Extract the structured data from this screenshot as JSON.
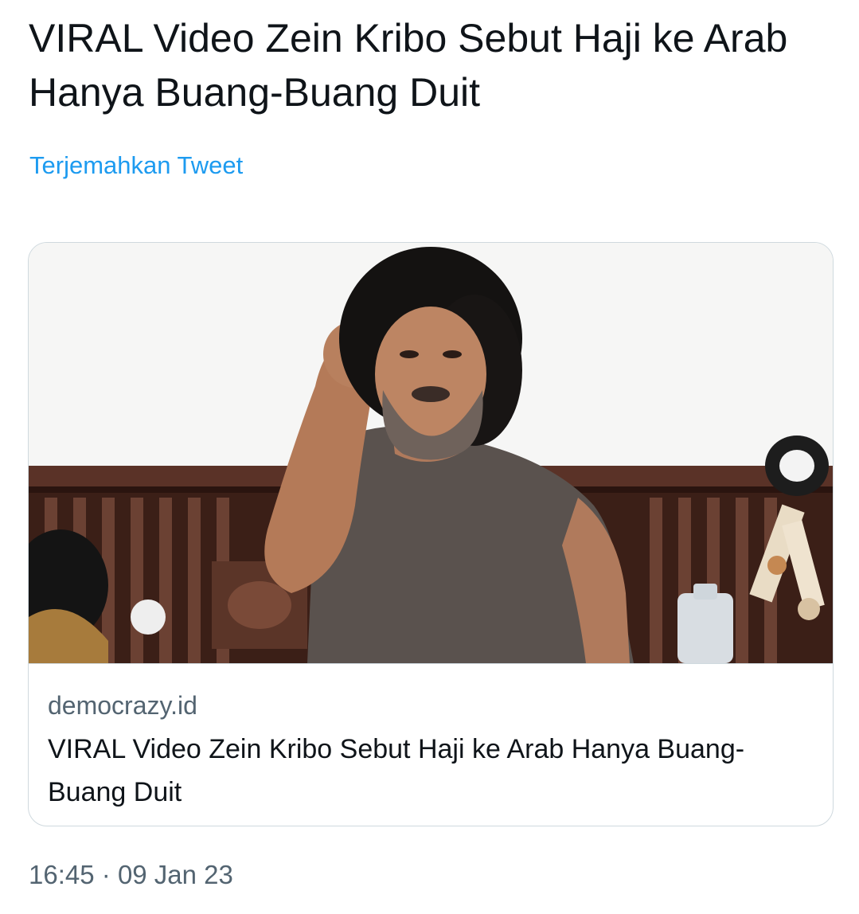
{
  "tweet": {
    "text": "VIRAL Video Zein Kribo Sebut Haji ke Arab Hanya Buang-Buang Duit",
    "translate_label": "Terjemahkan Tweet"
  },
  "link_card": {
    "domain": "democrazy.id",
    "title": "VIRAL Video Zein Kribo Sebut Haji ke Arab Hanya Buang-Buang Duit",
    "image_description_icon": "photo-thumbnail"
  },
  "meta": {
    "time": "16:45",
    "separator": "·",
    "date": "09 Jan 23"
  },
  "colors": {
    "text_primary": "#0f1419",
    "text_secondary": "#536471",
    "link": "#1d9bf0",
    "border": "#cfd9de"
  }
}
